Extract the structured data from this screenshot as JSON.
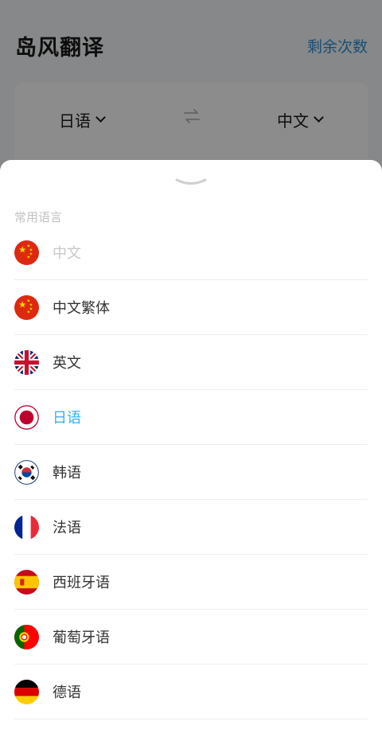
{
  "app": {
    "title": "岛风翻译",
    "remaining_label": "剩余次数",
    "source_lang": "日语",
    "target_lang": "中文"
  },
  "sheet": {
    "section_title": "常用语言",
    "items": [
      {
        "label": "中文",
        "flag": "china-flag-icon",
        "state": "disabled"
      },
      {
        "label": "中文繁体",
        "flag": "china-flag-icon",
        "state": "normal"
      },
      {
        "label": "英文",
        "flag": "uk-flag-icon",
        "state": "normal"
      },
      {
        "label": "日语",
        "flag": "japan-flag-icon",
        "state": "selected"
      },
      {
        "label": "韩语",
        "flag": "korea-flag-icon",
        "state": "normal"
      },
      {
        "label": "法语",
        "flag": "france-flag-icon",
        "state": "normal"
      },
      {
        "label": "西班牙语",
        "flag": "spain-flag-icon",
        "state": "normal"
      },
      {
        "label": "葡萄牙语",
        "flag": "portugal-flag-icon",
        "state": "normal"
      },
      {
        "label": "德语",
        "flag": "germany-flag-icon",
        "state": "normal"
      }
    ]
  },
  "colors": {
    "accent": "#3ab0ea",
    "link": "#2f8fd6",
    "disabled_text": "#c8c8c8",
    "overlay": "rgba(0,0,0,0.45)"
  }
}
